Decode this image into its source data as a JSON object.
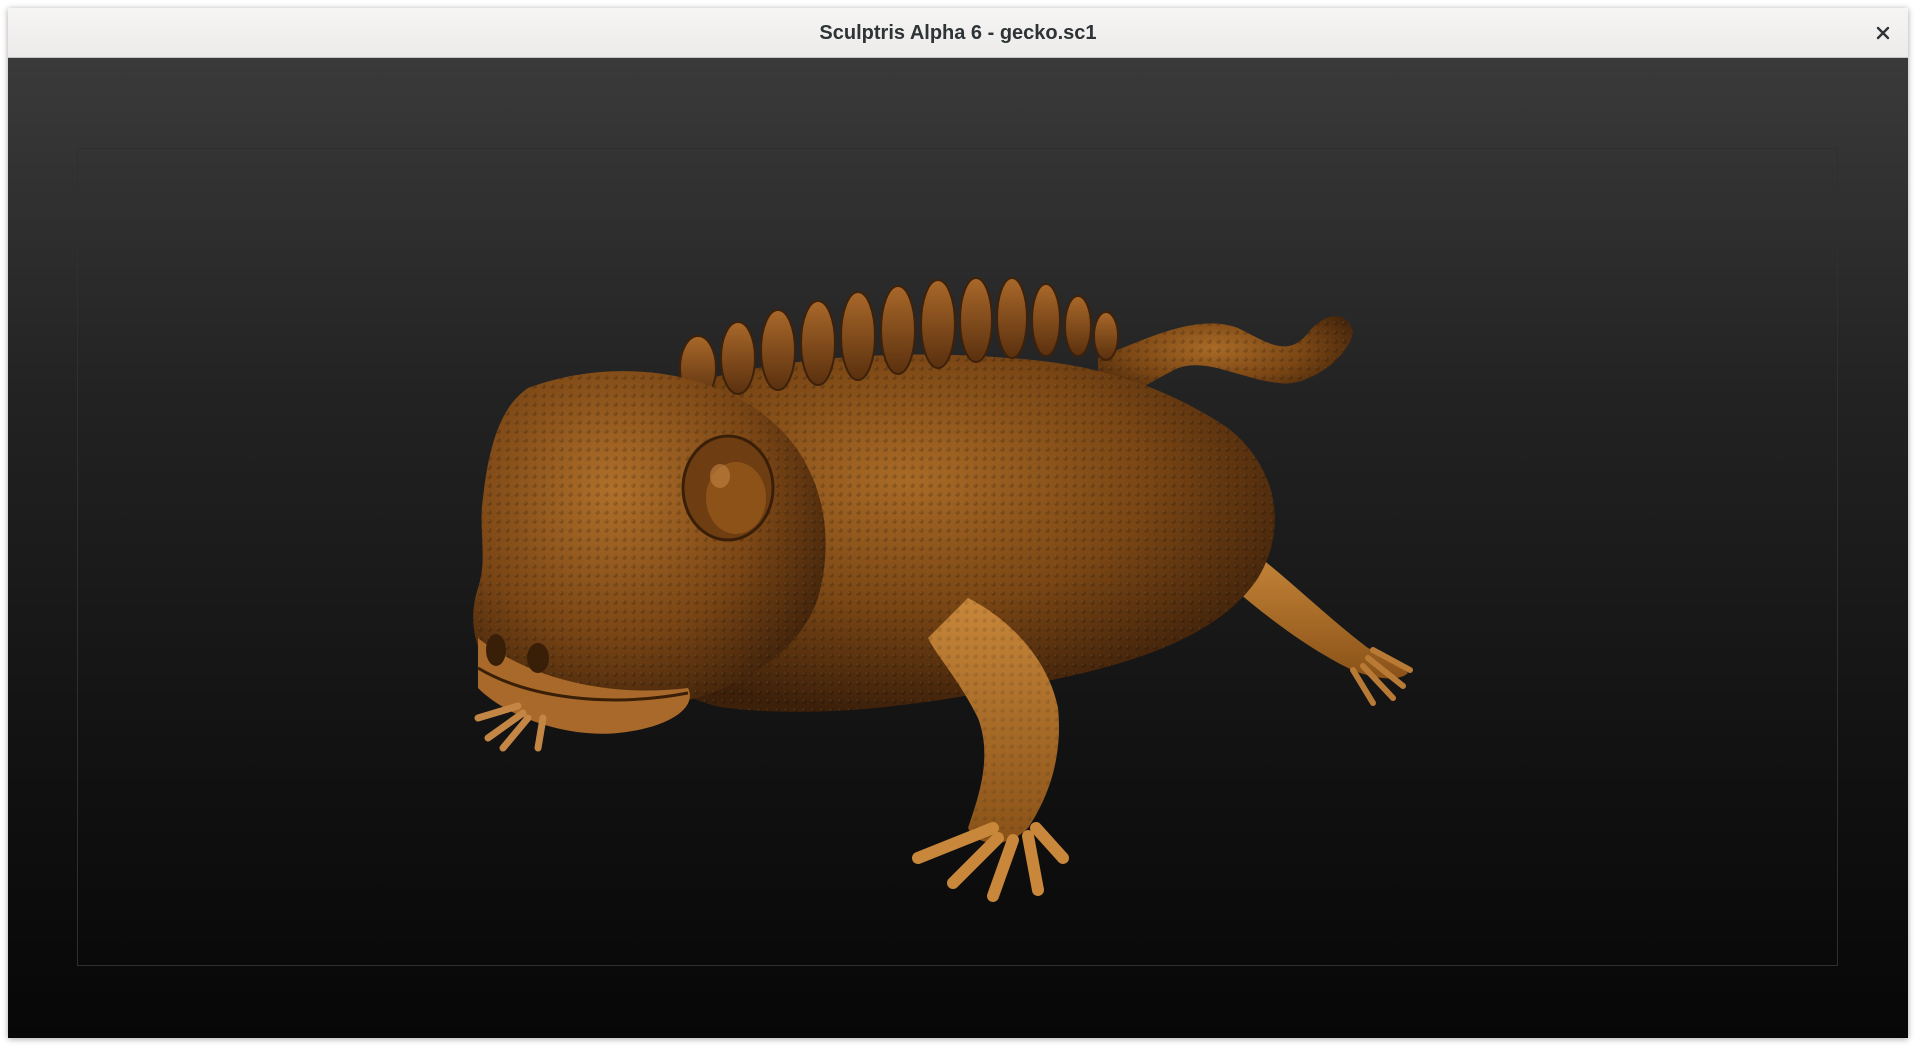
{
  "window": {
    "title": "Sculptris Alpha 6 - gecko.sc1"
  },
  "titlebar": {
    "close_icon": "close-icon"
  },
  "viewport": {
    "model_name": "gecko-model",
    "model_color": "#8a5218",
    "background_top": "#3a3a3a",
    "background_bottom": "#070707"
  }
}
